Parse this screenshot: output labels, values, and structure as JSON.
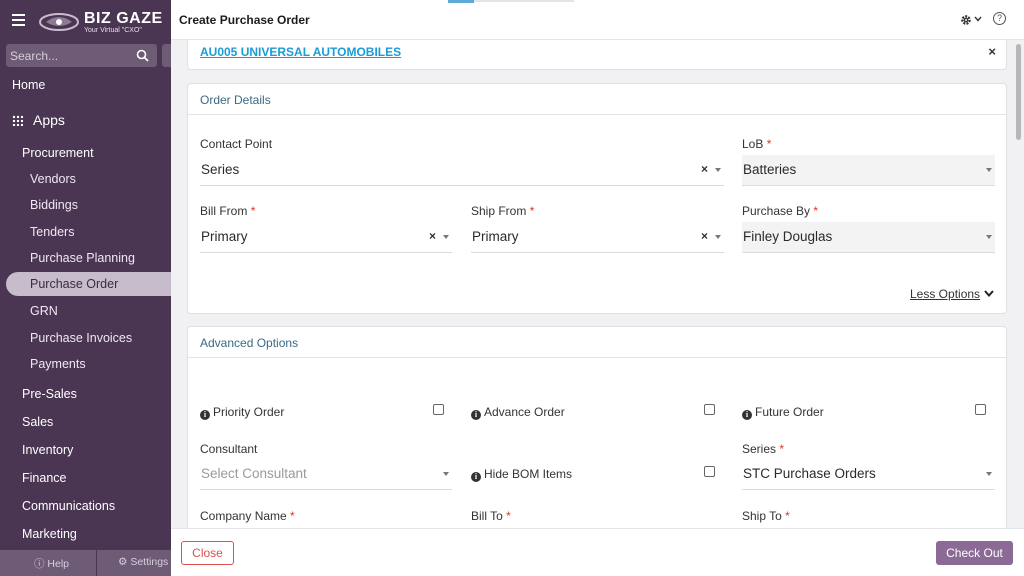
{
  "app": {
    "brand": "BIZ GAZE",
    "tagline": "Your Virtual \"CXO\""
  },
  "sidebar": {
    "search_placeholder": "Search...",
    "home": "Home",
    "apps": "Apps",
    "procurement": "Procurement",
    "procurement_items": [
      "Vendors",
      "Biddings",
      "Tenders",
      "Purchase Planning",
      "Purchase Order",
      "GRN",
      "Purchase Invoices",
      "Payments"
    ],
    "active_item": "Purchase Order",
    "sections": [
      "Pre-Sales",
      "Sales",
      "Inventory",
      "Finance",
      "Communications",
      "Marketing"
    ],
    "help": "Help",
    "settings": "Settings"
  },
  "header": {
    "title": "Create Purchase Order"
  },
  "customer": {
    "link": "AU005 UNIVERSAL AUTOMOBILES",
    "close_icon": "×"
  },
  "order_details": {
    "title": "Order Details",
    "contact_point": {
      "label": "Contact Point",
      "value": "Series"
    },
    "lob": {
      "label": "LoB",
      "value": "Batteries",
      "required": "*"
    },
    "bill_from": {
      "label": "Bill From",
      "value": "Primary",
      "required": "*"
    },
    "ship_from": {
      "label": "Ship From",
      "value": "Primary",
      "required": "*"
    },
    "purchase_by": {
      "label": "Purchase By",
      "value": "Finley Douglas",
      "required": "*"
    },
    "less_options": "Less Options"
  },
  "advanced_options": {
    "title": "Advanced Options",
    "priority_order": "Priority Order",
    "advance_order": "Advance Order",
    "future_order": "Future Order",
    "consultant": {
      "label": "Consultant",
      "placeholder": "Select Consultant"
    },
    "hide_bom_items": "Hide BOM Items",
    "series": {
      "label": "Series",
      "value": "STC Purchase Orders",
      "required": "*"
    },
    "company_name": {
      "label": "Company Name",
      "required": "*"
    },
    "bill_to": {
      "label": "Bill To",
      "required": "*"
    },
    "ship_to": {
      "label": "Ship To",
      "required": "*"
    }
  },
  "footer": {
    "close": "Close",
    "checkout": "Check Out"
  },
  "colors": {
    "sidebar_bg": "#4a3553",
    "accent": "#8b6a96",
    "link": "#1a9cd6",
    "required": "#e0302a"
  }
}
